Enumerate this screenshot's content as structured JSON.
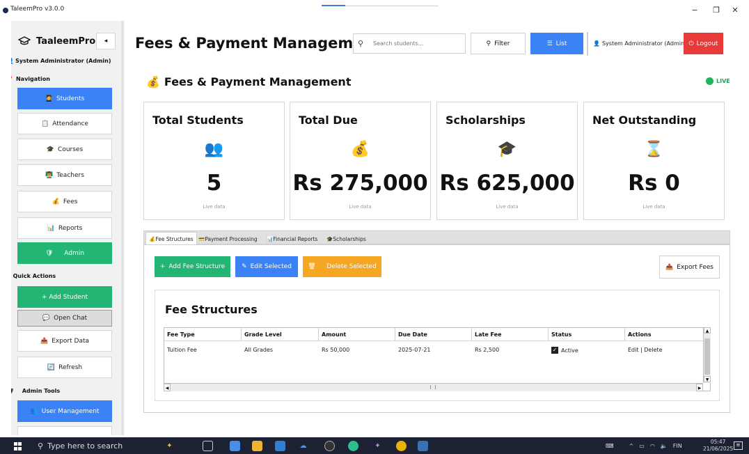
{
  "window": {
    "title": "TaleemPro v3.0.0",
    "minimize_glyph": "−",
    "maximize_glyph": "❐",
    "close_glyph": "✕"
  },
  "sidebar": {
    "brand": "TaaleemPro",
    "collapse_glyph": "◂",
    "user": "System Administrator (Admin)",
    "nav_heading": "Navigation",
    "nav_items": [
      {
        "label": "Students",
        "icon": "students-icon"
      },
      {
        "label": "Attendance",
        "icon": "attendance-icon"
      },
      {
        "label": "Courses",
        "icon": "courses-icon"
      },
      {
        "label": "Teachers",
        "icon": "teachers-icon"
      },
      {
        "label": "Fees",
        "icon": "fees-icon"
      },
      {
        "label": "Reports",
        "icon": "reports-icon"
      },
      {
        "label": "Admin",
        "icon": "shield-icon"
      }
    ],
    "quick_heading": "Quick Actions",
    "quick_items": [
      {
        "label": "+ Add Student"
      },
      {
        "label": "Open Chat"
      },
      {
        "label": "Export Data"
      },
      {
        "label": "Refresh"
      }
    ],
    "admin_heading": "Admin Tools",
    "admin_items": [
      {
        "label": "User Management"
      }
    ]
  },
  "header": {
    "title": "Fees & Payment Management",
    "search_placeholder": "Search students...",
    "filter_label": "Filter",
    "list_label": "List",
    "user_label": "System Administrator (Admin)",
    "logout_label": "Logout"
  },
  "section": {
    "title": "Fees & Payment Management",
    "live_label": "LIVE"
  },
  "stats": [
    {
      "title": "Total Students",
      "value": "5",
      "sub": "Live data",
      "icon": "students-icon"
    },
    {
      "title": "Total Due",
      "value": "Rs 275,000",
      "sub": "Live data",
      "icon": "money-bag-icon"
    },
    {
      "title": "Scholarships",
      "value": "Rs 625,000",
      "sub": "Live data",
      "icon": "graduation-cap-icon"
    },
    {
      "title": "Net Outstanding",
      "value": "Rs 0",
      "sub": "Live data",
      "icon": "hourglass-icon"
    }
  ],
  "tabs": [
    {
      "label": "Fee Structures"
    },
    {
      "label": "Payment Processing"
    },
    {
      "label": "Financial Reports"
    },
    {
      "label": "Scholarships"
    }
  ],
  "actions": {
    "add_label": "Add Fee Structure",
    "edit_label": "Edit Selected",
    "delete_label": "Delete Selected",
    "export_label": "Export Fees"
  },
  "fee_structures": {
    "title": "Fee Structures",
    "columns": [
      "Fee Type",
      "Grade Level",
      "Amount",
      "Due Date",
      "Late Fee",
      "Status",
      "Actions"
    ],
    "rows": [
      {
        "fee_type": "Tuition Fee",
        "grade": "All Grades",
        "amount": "Rs 50,000",
        "due": "2025-07-21",
        "late": "Rs 2,500",
        "status": "Active",
        "actions": "Edit | Delete"
      }
    ]
  },
  "taskbar": {
    "search_placeholder": "Type here to search",
    "lang": "FIN",
    "time": "05:47",
    "date": "21/06/2025"
  },
  "colors": {
    "primary_blue": "#3b82f6",
    "green": "#22b573",
    "orange": "#f5a623",
    "red": "#e93a3a"
  }
}
